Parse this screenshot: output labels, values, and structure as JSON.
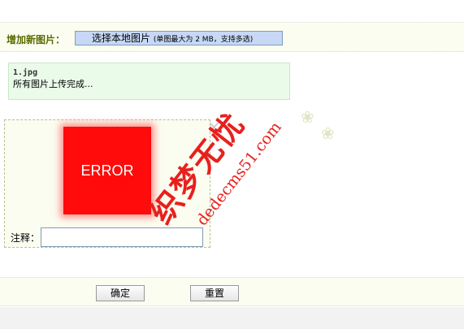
{
  "upload": {
    "label": "增加新图片：",
    "select_button": "选择本地图片",
    "select_hint": "(单图最大为 2 MB，支持多选)"
  },
  "status": {
    "file_name": "1.jpg",
    "message": "所有图片上传完成..."
  },
  "image_card": {
    "thumbnail_text": "ERROR",
    "close_symbol": "×",
    "note_label": "注释：",
    "note_value": ""
  },
  "watermark": {
    "brand": "织梦无忧",
    "url": "dedecms51.com"
  },
  "footer": {
    "ok_label": "确定",
    "reset_label": "重置"
  },
  "colors": {
    "error_red": "#ff0b0b",
    "watermark_red": "#e8201c",
    "select_button_bg": "#c6d8f6",
    "status_bg": "#eafbea"
  }
}
